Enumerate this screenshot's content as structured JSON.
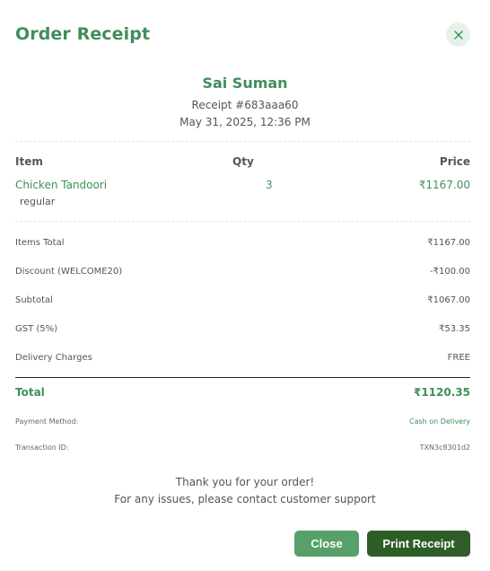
{
  "header": {
    "title": "Order Receipt"
  },
  "customer": {
    "name": "Sai Suman",
    "receipt_no": "Receipt #683aaa60",
    "date": "May 31, 2025, 12:36 PM"
  },
  "items_table": {
    "columns": [
      "Item",
      "Qty",
      "Price"
    ],
    "rows": [
      {
        "name": "Chicken Tandoori",
        "variant": "regular",
        "qty": "3",
        "price": "₹1167.00"
      }
    ]
  },
  "summary": [
    {
      "label": "Items Total",
      "value": "₹1167.00"
    },
    {
      "label": "Discount (WELCOME20)",
      "value": "-₹100.00"
    },
    {
      "label": "Subtotal",
      "value": "₹1067.00"
    },
    {
      "label": "GST (5%)",
      "value": "₹53.35"
    },
    {
      "label": "Delivery Charges",
      "value": "FREE"
    }
  ],
  "total": {
    "label": "Total",
    "value": "₹1120.35"
  },
  "payment": {
    "method_label": "Payment Method:",
    "method_value": "Cash on Delivery",
    "transaction_label": "Transaction ID:",
    "transaction_value": "TXN3c8301d2"
  },
  "footer": {
    "thanks": "Thank you for your order!",
    "support": "For any issues, please contact customer support"
  },
  "buttons": {
    "close": "Close",
    "print": "Print Receipt"
  },
  "colors": {
    "accent": "#3f8f5a",
    "close_button": "#57a06a",
    "print_button": "#2e5d27"
  }
}
